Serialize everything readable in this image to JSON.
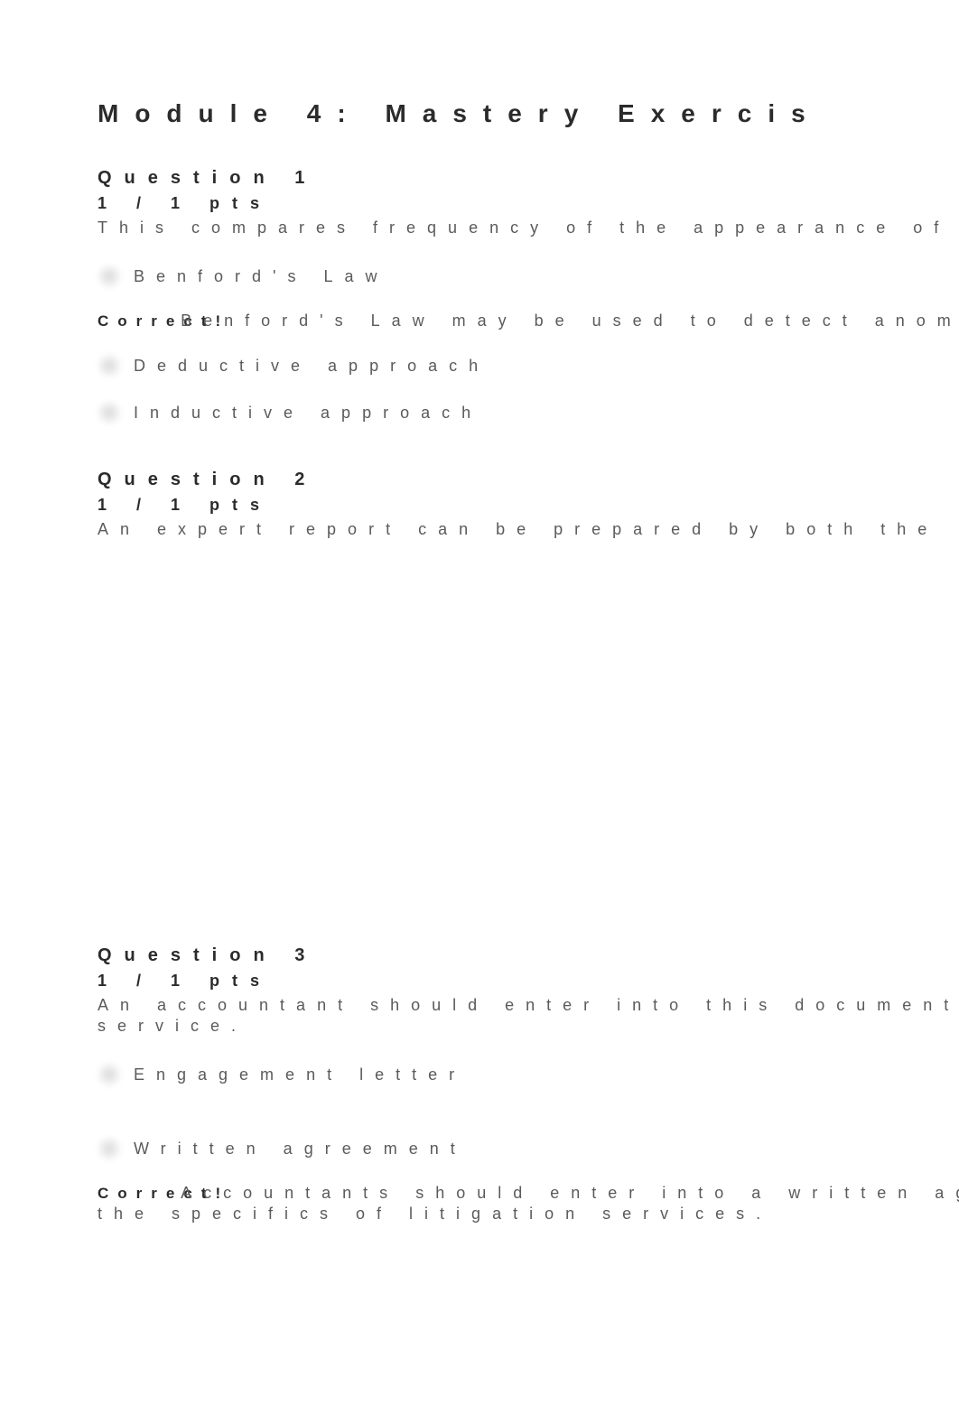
{
  "module": {
    "title": "Module 4: Mastery Exercis"
  },
  "q1": {
    "title": "Question 1",
    "pts": "1 / 1 pts",
    "prompt": "This compares frequency of the appearance of",
    "opt_a": "Benford's Law",
    "correct_label": "Correct!",
    "correct_text": "Benford's Law may be used to detect anomalies",
    "opt_b": "Deductive approach",
    "opt_c": "Inductive approach"
  },
  "q2": {
    "title": "Question 2",
    "pts": "1 / 1 pts",
    "prompt": "An expert report can be prepared by both the"
  },
  "q3": {
    "title": "Question 3",
    "pts": "1 / 1 pts",
    "prompt_l1": "An accountant should enter into this document",
    "prompt_l2": "service.",
    "opt_a": "Engagement letter",
    "opt_b": "Written agreement",
    "correct_label": "Correct!",
    "correct_text_l1": "Accountants should enter into a written agre",
    "correct_text_l2": "the specifics of litigation services."
  }
}
